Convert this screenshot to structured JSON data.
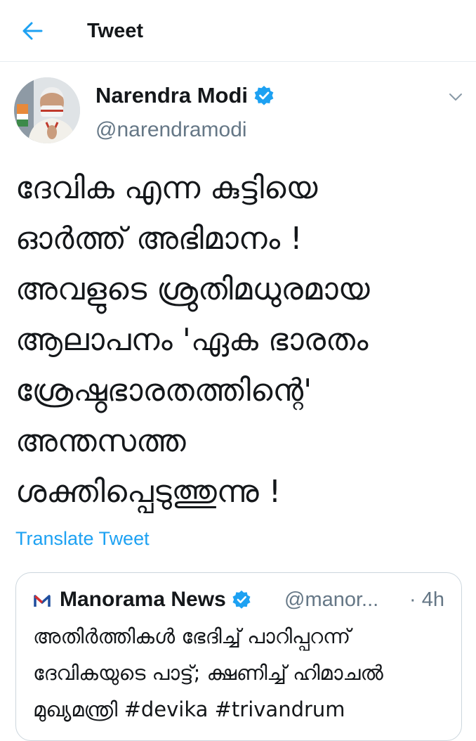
{
  "header": {
    "title": "Tweet",
    "back_icon": "back-arrow-icon"
  },
  "tweet": {
    "author": {
      "name": "Narendra Modi",
      "handle": "@narendramodi",
      "verified": true
    },
    "text_lines": [
      "ദേവിക എന്ന കുട്ടിയെ",
      "ഓർത്ത് അഭിമാനം !",
      "അവളുടെ ശ്രുതിമധുരമായ",
      "ആലാപനം 'ഏക ഭാരതം",
      "ശ്രേഷ്ഠഭാരതത്തിന്റെ'",
      "അന്തസത്ത",
      "ശക്തിപ്പെടുത്തുന്നു !"
    ],
    "translate_label": "Translate Tweet",
    "menu_icon": "chevron-down-icon"
  },
  "quote": {
    "author_name": "Manorama News",
    "handle": "@manor...",
    "separator": "·",
    "time": "4h",
    "verified": true,
    "text_lines": [
      "അതിർത്തികൾ ഭേദിച്ച് പാറിപ്പറന്ന്",
      "ദേവികയുടെ പാട്ട്; ക്ഷണിച്ച് ഹിമാചൽ",
      "മുഖ്യമന്ത്രി #devika #trivandrum"
    ]
  },
  "colors": {
    "accent": "#1da1f2",
    "verified": "#1da1f2",
    "secondary_text": "#657786",
    "border": "#ccd6dd"
  }
}
